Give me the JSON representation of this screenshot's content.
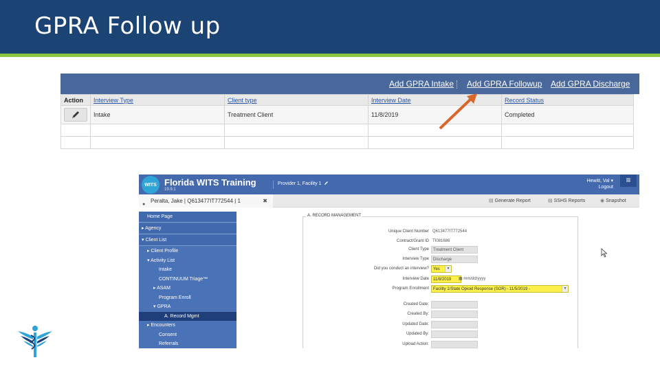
{
  "slide": {
    "title": "GPRA Follow up",
    "colors": {
      "header_bg": "#1b4374",
      "accent_line": "#8dc63f"
    }
  },
  "grid": {
    "toolbar_links": [
      "Add GPRA Intake",
      "Add GPRA Followup",
      "Add GPRA Discharge"
    ],
    "columns": [
      "Action",
      "Interview Type",
      "Client type",
      "Interview Date",
      "Record Status"
    ],
    "rows": [
      {
        "interview_type": "Intake",
        "client_type": "Treatment Client",
        "interview_date": "11/8/2019",
        "record_status": "Completed"
      }
    ]
  },
  "wits": {
    "app_title": "Florida WITS Training",
    "version": "19.9.1",
    "provider": "Provider 1, Facility 1",
    "user_name": "Hewitt, Val",
    "logout": "Logout",
    "menu_icon": "hamburger-icon",
    "client_tab": "Peralta, Jake | Q613477IT772544 | 1",
    "subbar_links": [
      "Generate Report",
      "SSHS Reports",
      "Snapshot"
    ],
    "nav_items": [
      {
        "label": "Home Page",
        "level": 0,
        "boxed": true
      },
      {
        "label": "Agency",
        "level": 0,
        "boxed": true,
        "caret": "right"
      },
      {
        "label": "Client List",
        "level": 0,
        "boxed": true,
        "caret": "down"
      },
      {
        "label": "Client Profile",
        "level": 1,
        "caret": "right"
      },
      {
        "label": "Activity List",
        "level": 1,
        "caret": "down"
      },
      {
        "label": "Intake",
        "level": 2
      },
      {
        "label": "CONTINUUM Triage™",
        "level": 2
      },
      {
        "label": "ASAM",
        "level": 2,
        "caret": "right"
      },
      {
        "label": "Program Enroll",
        "level": 2
      },
      {
        "label": "GPRA",
        "level": 2,
        "caret": "down"
      },
      {
        "label": "A. Record Mgmt",
        "level": 3,
        "active": true
      },
      {
        "label": "Encounters",
        "level": 1,
        "caret": "right"
      },
      {
        "label": "Consent",
        "level": 2
      },
      {
        "label": "Referrals",
        "level": 2
      }
    ],
    "record_section": "A. RECORD MANAGEMENT",
    "fields": [
      {
        "label": "Unique Client Number",
        "value": "Q613477IT772544",
        "style": "plain"
      },
      {
        "label": "Contract/Grant ID",
        "value": "TI081686",
        "style": "plain"
      },
      {
        "label": "Client Type",
        "value": "Treatment Client",
        "style": "grey"
      },
      {
        "label": "Interview Type",
        "value": "Discharge",
        "style": "grey"
      },
      {
        "label": "Did you conduct an interview?",
        "value": "Yes",
        "style": "yellow",
        "dropdown": true
      },
      {
        "label": "Interview Date",
        "value": "11/8/2019",
        "style": "yellow",
        "extra": "mm/dd/yyyy"
      },
      {
        "label": "Program Enrollment",
        "value": "Facility 1/State Opioid Response (SOR) - 11/5/2019 -",
        "style": "yellow",
        "dropdown": true
      },
      {
        "label": "Created Date:",
        "value": "",
        "style": "grey"
      },
      {
        "label": "Created By:",
        "value": "",
        "style": "grey"
      },
      {
        "label": "Updated Date:",
        "value": "",
        "style": "grey"
      },
      {
        "label": "Updated By:",
        "value": "",
        "style": "grey"
      },
      {
        "label": "Upload Action:",
        "value": "",
        "style": "grey"
      },
      {
        "label": "Upload Date:",
        "value": "",
        "style": "grey"
      }
    ]
  }
}
